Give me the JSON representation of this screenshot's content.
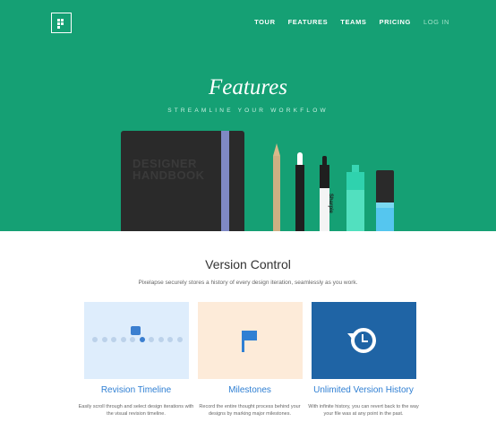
{
  "nav": {
    "items": [
      "TOUR",
      "FEATURES",
      "TEAMS",
      "PRICING"
    ],
    "login": "LOG IN"
  },
  "hero": {
    "title": "Features",
    "subtitle": "STREAMLINE YOUR WORKFLOW",
    "notebook_text": "DESIGNER HANDBOOK",
    "sharpie_text": "Sharpie"
  },
  "section": {
    "title": "Version Control",
    "description": "Pixelapse securely stores a history of every design iteration, seamlessly as you work."
  },
  "cards": [
    {
      "title": "Revision Timeline",
      "description": "Easily scroll through and select design iterations with the visual revision timeline.",
      "icon": "timeline-icon"
    },
    {
      "title": "Milestones",
      "description": "Record the entire thought process behind your designs by marking major milestones.",
      "icon": "flag-icon"
    },
    {
      "title": "Unlimited Version History",
      "description": "With infinite history, you can revert back to the way your file was at any point in the past.",
      "icon": "history-icon"
    }
  ],
  "colors": {
    "hero": "#15a074",
    "accent": "#2f7fd3",
    "card1": "#deedfc",
    "card2": "#fdebd9",
    "card3": "#1f64a5"
  }
}
